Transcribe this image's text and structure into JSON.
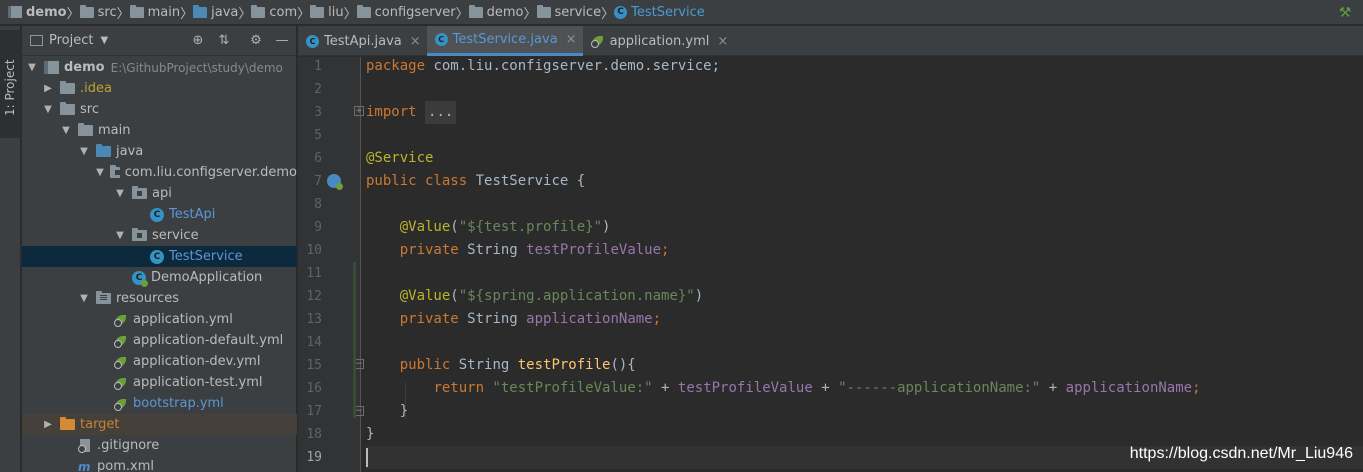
{
  "breadcrumb": {
    "items": [
      "demo",
      "src",
      "main",
      "java",
      "com",
      "liu",
      "configserver",
      "demo",
      "service",
      "TestService"
    ]
  },
  "stripe": {
    "project_tab": "1: Project"
  },
  "panel": {
    "title": "Project",
    "tree": [
      {
        "label": "demo",
        "path": "E:\\GithubProject\\study\\demo"
      },
      {
        "label": ".idea"
      },
      {
        "label": "src"
      },
      {
        "label": "main"
      },
      {
        "label": "java"
      },
      {
        "label": "com.liu.configserver.demo"
      },
      {
        "label": "api"
      },
      {
        "label": "TestApi"
      },
      {
        "label": "service"
      },
      {
        "label": "TestService"
      },
      {
        "label": "DemoApplication"
      },
      {
        "label": "resources"
      },
      {
        "label": "application.yml"
      },
      {
        "label": "application-default.yml"
      },
      {
        "label": "application-dev.yml"
      },
      {
        "label": "application-test.yml"
      },
      {
        "label": "bootstrap.yml"
      },
      {
        "label": "target"
      },
      {
        "label": ".gitignore"
      },
      {
        "label": "pom.xml"
      }
    ]
  },
  "tabs": [
    {
      "label": "TestApi.java",
      "icon": "class-icon"
    },
    {
      "label": "TestService.java",
      "icon": "class-icon",
      "active": true
    },
    {
      "label": "application.yml",
      "icon": "spring-yml-icon"
    }
  ],
  "editor": {
    "line_numbers": [
      "1",
      "2",
      "3",
      "5",
      "6",
      "7",
      "8",
      "9",
      "10",
      "11",
      "12",
      "13",
      "14",
      "15",
      "16",
      "17",
      "18",
      "19"
    ],
    "lines": {
      "l1_kw": "package",
      "l1_rest": " com.liu.configserver.demo.service;",
      "l3_kw": "import",
      "l3_fold": "...",
      "l6_ann": "@Service",
      "l7_kw": "public class",
      "l7_rest": " TestService {",
      "l9_ann": "@Value",
      "l9_str": "\"${test.profile}\"",
      "l10_kw": "private",
      "l10_type": " String ",
      "l10_fld": "testProfileValue",
      "l12_ann": "@Value",
      "l12_str": "\"${spring.application.name}\"",
      "l13_kw": "private",
      "l13_type": " String ",
      "l13_fld": "applicationName",
      "l15_kw": "public",
      "l15_type": " String ",
      "l15_mth": "testProfile",
      "l15_rest": "(){",
      "l16_kw": "return",
      "l16_str1": "\"testProfileValue:\"",
      "l16_plus1": " + ",
      "l16_fld1": "testProfileValue",
      "l16_plus2": " + ",
      "l16_str2": "\"------applicationName:\"",
      "l16_plus3": " + ",
      "l16_fld2": "applicationName",
      "l17": "}",
      "l18": "}"
    }
  },
  "watermark": "https://blog.csdn.net/Mr_Liu946",
  "colors": {
    "keyword": "#cc7832",
    "annotation": "#bbb529",
    "string": "#6a8759",
    "field": "#9876aa",
    "method": "#ffc66d",
    "selection": "#0d293e"
  }
}
